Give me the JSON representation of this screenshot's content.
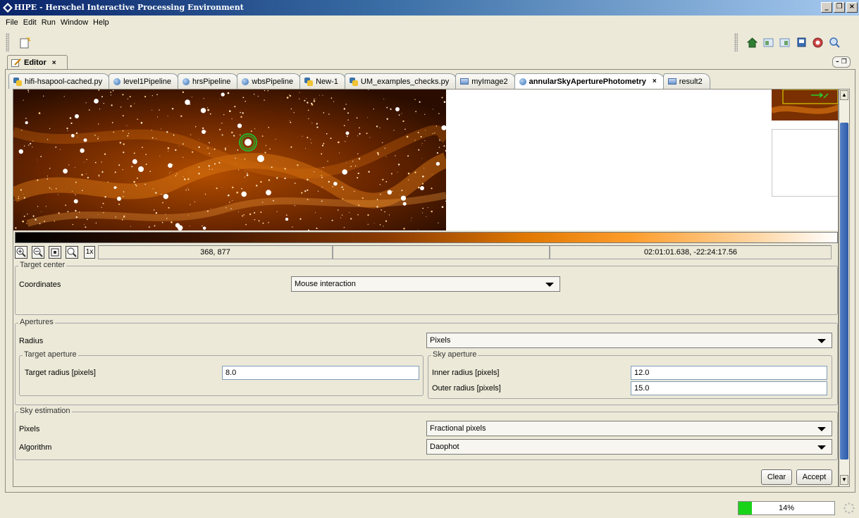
{
  "window": {
    "title": "HIPE - Herschel Interactive Processing Environment",
    "minimize": "_",
    "maximize": "❐",
    "close": "×"
  },
  "menu": [
    "File",
    "Edit",
    "Run",
    "Window",
    "Help"
  ],
  "editor_tab": {
    "label": "Editor",
    "close": "×"
  },
  "view_controls": "– ❐",
  "doc_tabs": [
    {
      "label": "hifi-hsapool-cached.py",
      "icon": "python-file-icon"
    },
    {
      "label": "level1Pipeline",
      "icon": "variable-dot-icon"
    },
    {
      "label": "hrsPipeline",
      "icon": "variable-dot-icon"
    },
    {
      "label": "wbsPipeline",
      "icon": "variable-dot-icon"
    },
    {
      "label": "New-1",
      "icon": "python-file-icon"
    },
    {
      "label": "UM_examples_checks.py",
      "icon": "python-file-icon"
    },
    {
      "label": "myImage2",
      "icon": "image-icon"
    },
    {
      "label": "annularSkyAperturePhotometry",
      "icon": "variable-dot-icon",
      "active": true,
      "close": "×"
    },
    {
      "label": "result2",
      "icon": "image-icon"
    }
  ],
  "image_status": {
    "zoom_label": "1x",
    "pixel_coords": "368, 877",
    "value": "",
    "world_coords": "02:01:01.638, -22:24:17.56"
  },
  "target_center": {
    "title": "Target center",
    "coordinates_label": "Coordinates",
    "coordinates_value": "Mouse interaction"
  },
  "apertures": {
    "title": "Apertures",
    "radius_label": "Radius",
    "radius_unit": "Pixels",
    "target": {
      "title": "Target aperture",
      "radius_label": "Target radius [pixels]",
      "radius_value": "8.0"
    },
    "sky": {
      "title": "Sky aperture",
      "inner_label": "Inner radius [pixels]",
      "inner_value": "12.0",
      "outer_label": "Outer radius [pixels]",
      "outer_value": "15.0"
    }
  },
  "sky_estimation": {
    "title": "Sky estimation",
    "pixels_label": "Pixels",
    "pixels_value": "Fractional pixels",
    "algorithm_label": "Algorithm",
    "algorithm_value": "Daophot"
  },
  "buttons": {
    "clear": "Clear",
    "accept": "Accept"
  },
  "memory": {
    "percent_text": "14%",
    "fraction": 0.14,
    "color": "#19d319"
  },
  "colors": {
    "accent_title": "#0a246a",
    "image_orange": "#e07800"
  }
}
